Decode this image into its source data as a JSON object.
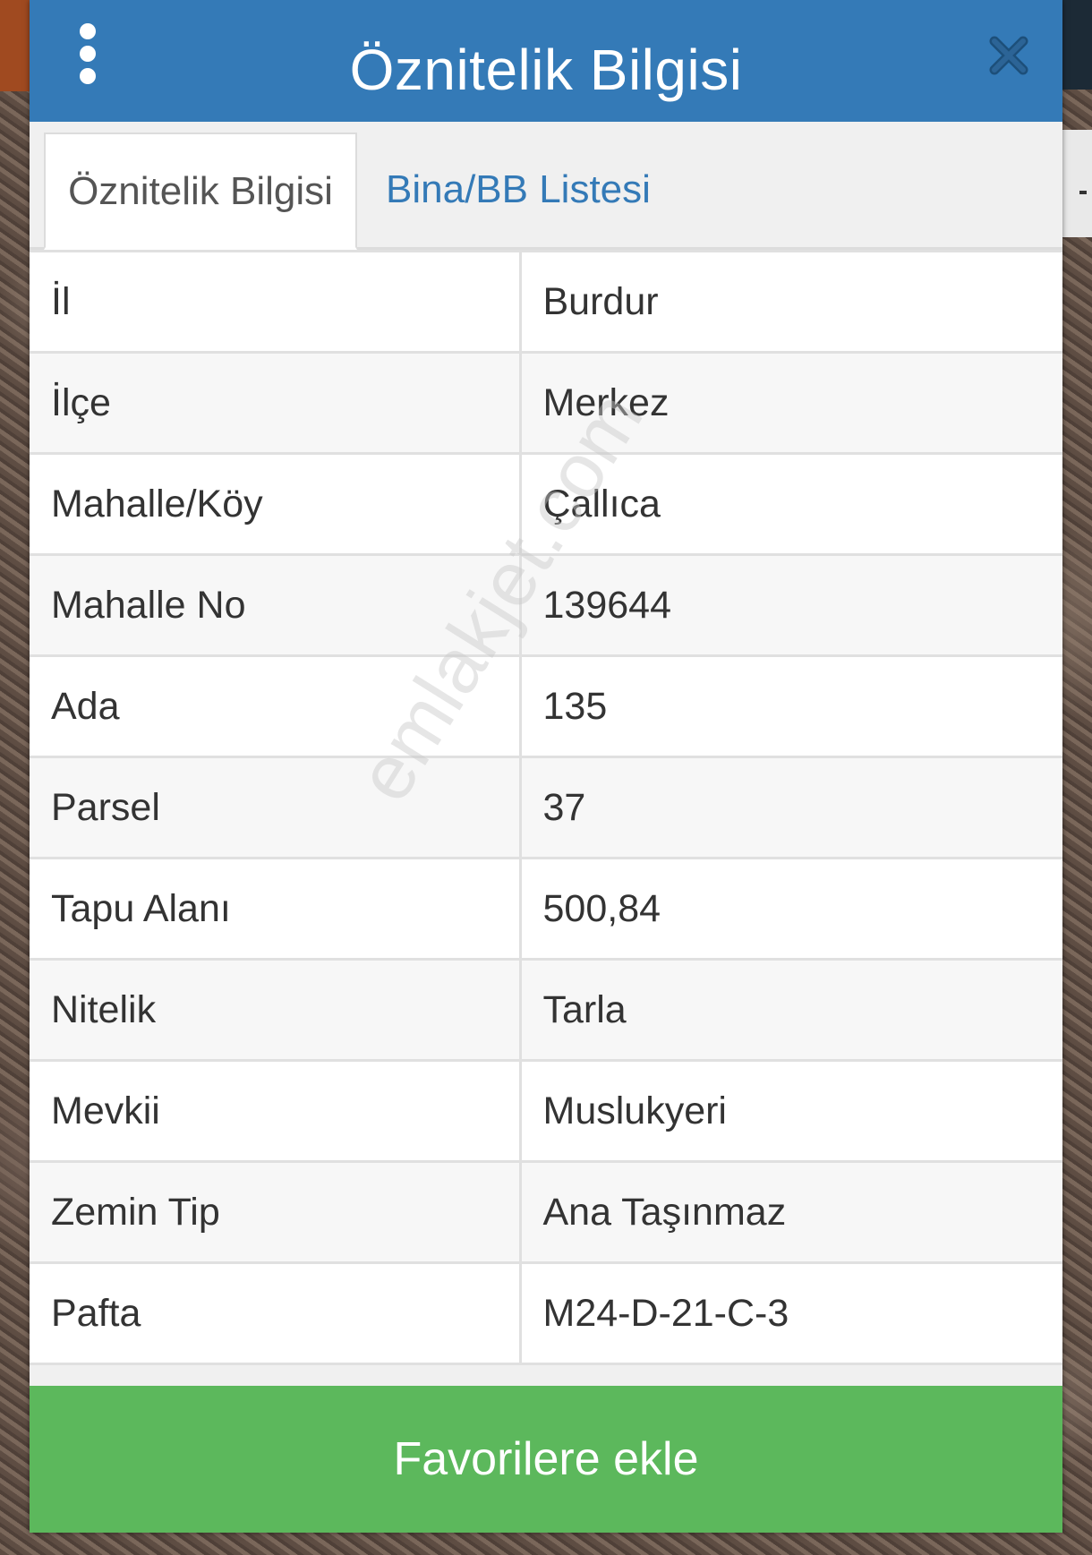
{
  "dialog": {
    "title": "Öznitelik Bilgisi",
    "menu_icon": "more-vertical-icon",
    "close_icon": "close-icon"
  },
  "tabs": [
    {
      "label": "Öznitelik Bilgisi",
      "active": true
    },
    {
      "label": "Bina/BB Listesi",
      "active": false
    }
  ],
  "rows": [
    {
      "key": "İl",
      "value": "Burdur"
    },
    {
      "key": "İlçe",
      "value": "Merkez"
    },
    {
      "key": "Mahalle/Köy",
      "value": "Çallıca"
    },
    {
      "key": "Mahalle No",
      "value": "139644"
    },
    {
      "key": "Ada",
      "value": "135"
    },
    {
      "key": "Parsel",
      "value": "37"
    },
    {
      "key": "Tapu Alanı",
      "value": "500,84"
    },
    {
      "key": "Nitelik",
      "value": "Tarla"
    },
    {
      "key": "Mevkii",
      "value": "Muslukyeri"
    },
    {
      "key": "Zemin Tip",
      "value": "Ana Taşınmaz"
    },
    {
      "key": "Pafta",
      "value": "M24-D-21-C-3"
    }
  ],
  "favorite_button": {
    "label": "Favorilere ekle"
  },
  "watermark": "emlakjet.com",
  "colors": {
    "header": "#347ab7",
    "tab_link": "#347ab7",
    "button": "#5cb85c"
  }
}
